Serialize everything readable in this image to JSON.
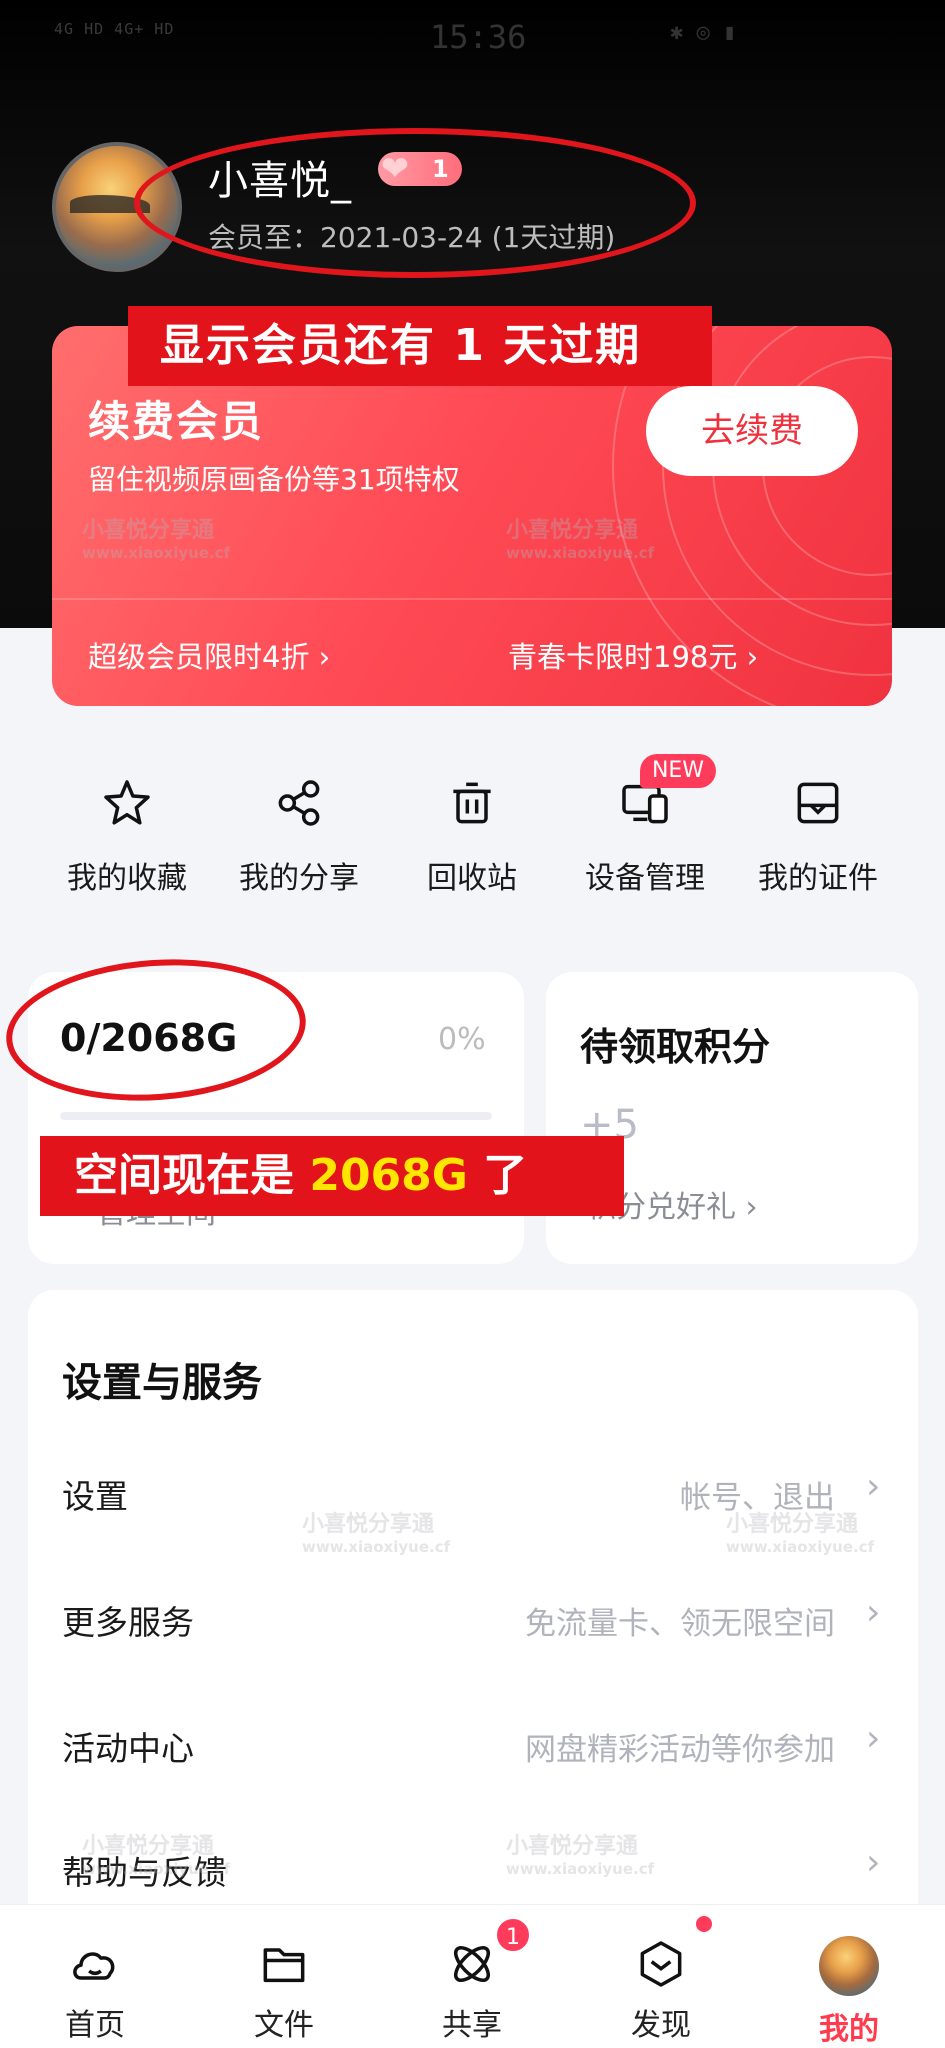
{
  "status_bar": {
    "network": "4G HD 4G+ HD",
    "time": "15:36",
    "right": "✱ ◎ ▮"
  },
  "profile": {
    "username": "小喜悦_",
    "vip_level": "1",
    "member_until": "会员至：2021-03-24 (1天过期)"
  },
  "annotations": {
    "member_callout": "显示会员还有 1 天过期",
    "space_callout_prefix": "空间现在是 ",
    "space_callout_value": "2068G",
    "space_callout_suffix": " 了",
    "highlight_color": "#e3131b"
  },
  "renew_card": {
    "title": "续费会员",
    "subtitle": "留住视频原画备份等31项特权",
    "button": "去续费",
    "promo_left": "超级会员限时4折 ›",
    "promo_right": "青春卡限时198元 ›"
  },
  "quick_actions": [
    {
      "label": "我的收藏",
      "icon": "star-icon"
    },
    {
      "label": "我的分享",
      "icon": "share-icon"
    },
    {
      "label": "回收站",
      "icon": "trash-icon"
    },
    {
      "label": "设备管理",
      "icon": "devices-icon",
      "badge": "NEW"
    },
    {
      "label": "我的证件",
      "icon": "id-card-icon"
    }
  ],
  "storage": {
    "used": "0/2068G",
    "percent": "0%",
    "fill_fraction": 0,
    "link": "管理空间"
  },
  "points": {
    "title": "待领取积分",
    "value": "+5",
    "subtitle": "积分兑好礼 ›"
  },
  "settings": {
    "title": "设置与服务",
    "rows": [
      {
        "label": "设置",
        "hint": "帐号、退出"
      },
      {
        "label": "更多服务",
        "hint": "免流量卡、领无限空间"
      },
      {
        "label": "活动中心",
        "hint": "网盘精彩活动等你参加"
      },
      {
        "label": "帮助与反馈",
        "hint": ""
      }
    ]
  },
  "watermark": {
    "line1": "小喜悦分享通",
    "line2": "www.xiaoxiyue.cf"
  },
  "tabbar": {
    "tabs": [
      {
        "label": "首页",
        "icon": "home-cloud-icon"
      },
      {
        "label": "文件",
        "icon": "folder-icon"
      },
      {
        "label": "共享",
        "icon": "atom-icon",
        "badge": "1"
      },
      {
        "label": "发现",
        "icon": "discover-box-icon"
      },
      {
        "label": "我的",
        "icon": "avatar",
        "active": true
      }
    ]
  },
  "colors": {
    "accent": "#ff3b4d",
    "card_red": "#ff4b55",
    "header_bg": "#000000"
  }
}
